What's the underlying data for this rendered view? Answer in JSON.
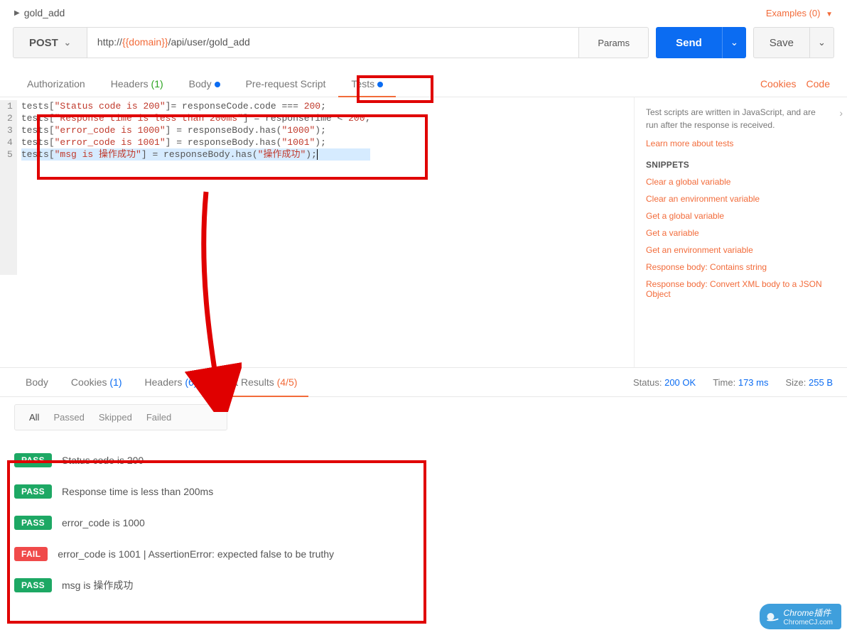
{
  "header": {
    "title": "gold_add",
    "examples_label": "Examples (0)"
  },
  "request": {
    "method": "POST",
    "url_prefix": "http://",
    "url_var": "{{domain}}",
    "url_suffix": "/api/user/gold_add",
    "params_label": "Params",
    "send_label": "Send",
    "save_label": "Save"
  },
  "tabs": {
    "authorization": "Authorization",
    "headers": "Headers",
    "headers_count": "(1)",
    "body": "Body",
    "prerequest": "Pre-request Script",
    "tests": "Tests",
    "cookies": "Cookies",
    "code": "Code"
  },
  "code": {
    "lines": [
      {
        "n": "1",
        "tests": "tests",
        "key": "\"Status code is 200\"",
        "mid": "]= responseCode.code === ",
        "num": "200",
        "tail": ";"
      },
      {
        "n": "2",
        "tests": "tests",
        "key": "\"Response time is less than 200ms\"",
        "mid": "] = responseTime < ",
        "num": "200",
        "tail": ";"
      },
      {
        "n": "3",
        "tests": "tests",
        "key": "\"error_code is 1000\"",
        "mid": "] = responseBody.has(",
        "num": "\"1000\"",
        "tail": ");"
      },
      {
        "n": "4",
        "tests": "tests",
        "key": "\"error_code is 1001\"",
        "mid": "] = responseBody.has(",
        "num": "\"1001\"",
        "tail": ");"
      },
      {
        "n": "5",
        "tests": "tests",
        "key": "\"msg is 操作成功\"",
        "mid": "] = responseBody.has(",
        "num": "\"操作成功\"",
        "tail": ");"
      }
    ]
  },
  "side": {
    "info": "Test scripts are written in JavaScript, and are run after the response is received.",
    "learn": "Learn more about tests",
    "snippets_hdr": "SNIPPETS",
    "snippets": [
      "Clear a global variable",
      "Clear an environment variable",
      "Get a global variable",
      "Get a variable",
      "Get an environment variable",
      "Response body: Contains string",
      "Response body: Convert XML body to a JSON Object"
    ]
  },
  "resTabs": {
    "body": "Body",
    "cookies": "Cookies",
    "cookies_cnt": "(1)",
    "headers": "Headers",
    "headers_cnt": "(6)",
    "testresults": "Test Results",
    "testresults_cnt": "(4/5)"
  },
  "resMeta": {
    "status_lbl": "Status:",
    "status_val": "200 OK",
    "time_lbl": "Time:",
    "time_val": "173 ms",
    "size_lbl": "Size:",
    "size_val": "255 B"
  },
  "filters": {
    "all": "All",
    "passed": "Passed",
    "skipped": "Skipped",
    "failed": "Failed"
  },
  "results": [
    {
      "status": "PASS",
      "text": "Status code is 200"
    },
    {
      "status": "PASS",
      "text": "Response time is less than 200ms"
    },
    {
      "status": "PASS",
      "text": "error_code is 1000"
    },
    {
      "status": "FAIL",
      "text": "error_code is 1001 | AssertionError: expected false to be truthy"
    },
    {
      "status": "PASS",
      "text": "msg is 操作成功"
    }
  ],
  "watermark": {
    "top": "Chrome插件",
    "bottom": "ChromeCJ.com"
  }
}
